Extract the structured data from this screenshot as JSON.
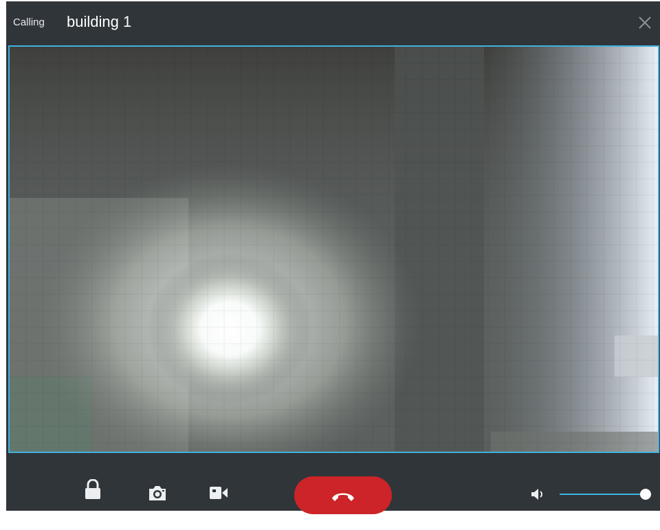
{
  "window": {
    "title_prefix": "Calling",
    "title_name": "building 1"
  },
  "icons": {
    "close": "close-icon",
    "lock": "lock-icon",
    "snapshot": "camera-icon",
    "record": "video-camera-icon",
    "hangup": "phone-hangup-icon",
    "speaker": "speaker-icon"
  },
  "colors": {
    "window_bg": "#30353a",
    "video_border": "#43b2dd",
    "hangup": "#cc2428",
    "volume_accent": "#3fb5e4"
  },
  "controls": {
    "volume_level": 1.0
  }
}
